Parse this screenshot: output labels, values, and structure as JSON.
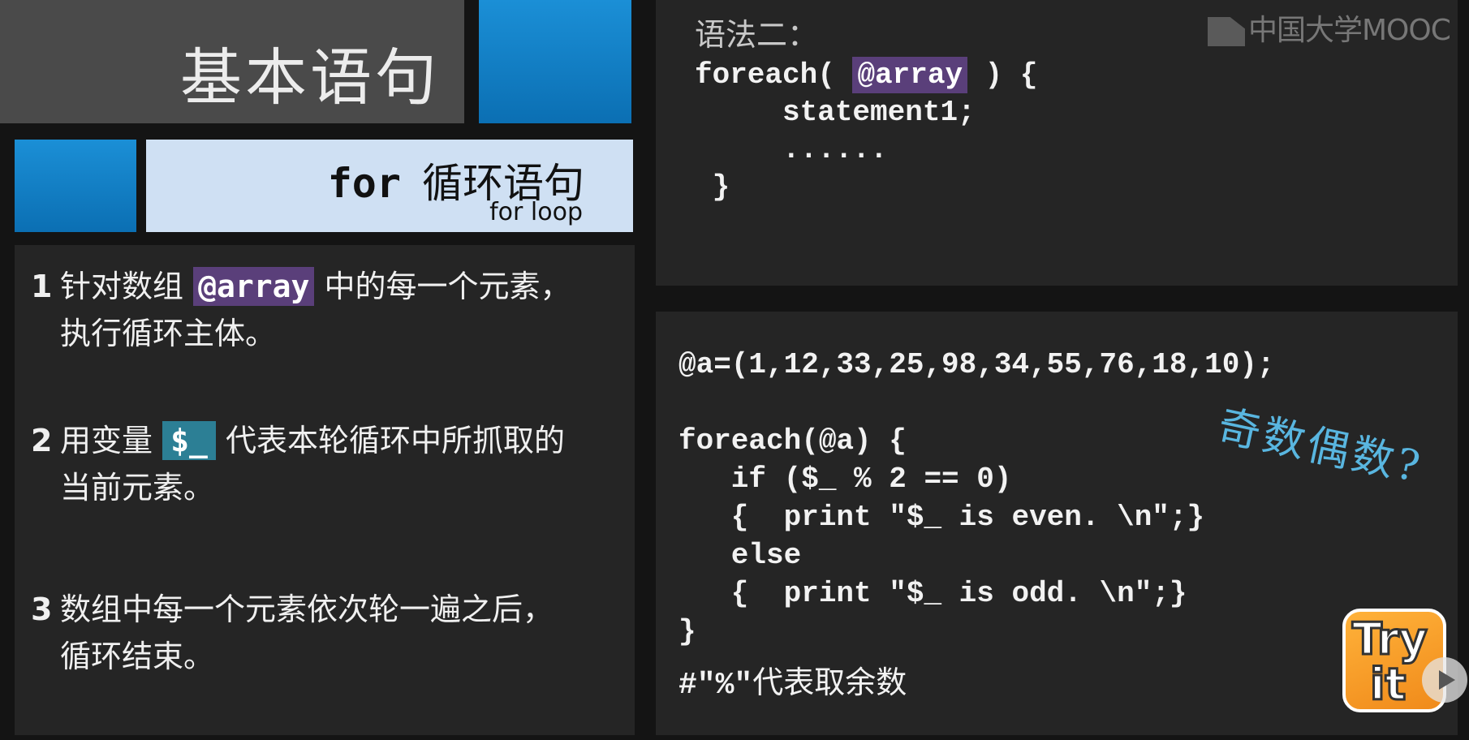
{
  "header": {
    "title": "基本语句",
    "subtitle_keyword": "for",
    "subtitle_text": "循环语句",
    "subtitle_en": "for loop"
  },
  "points": [
    {
      "num": "1",
      "before": "针对数组",
      "tag": "@array",
      "after": "中的每一个元素，",
      "line2": "执行循环主体。"
    },
    {
      "num": "2",
      "before": "用变量",
      "tag": "$_",
      "after": "代表本轮循环中所抓取的",
      "line2": "当前元素。"
    },
    {
      "num": "3",
      "before": "数组中每一个元素依次轮一遍之后，",
      "line2": "循环结束。"
    }
  ],
  "syntax": {
    "title": "语法二：",
    "line1_pre": "foreach( ",
    "line1_tag": "@array",
    "line1_post": " ) {",
    "line2": "     statement1;",
    "line3": "     ......",
    "line4": " }"
  },
  "watermark": "中国大学MOOC",
  "example": {
    "code": "@a=(1,12,33,25,98,34,55,76,18,10);\n\nforeach(@a) {\n   if ($_ % 2 == 0)\n   {  print \"$_ is even. \\n\";}\n   else\n   {  print \"$_ is odd. \\n\";}\n}",
    "comment_hash": "#\"%\"",
    "comment_text": "代表取余数",
    "handwritten_note": "奇数偶数?"
  },
  "badge": {
    "line1": "Try",
    "line2": "it"
  },
  "colors": {
    "blue": "#1b8fd6",
    "purple_tag": "#5a3f7a",
    "teal_tag": "#2c7f95",
    "note": "#59b6e0",
    "badge": "#f5a02a"
  }
}
